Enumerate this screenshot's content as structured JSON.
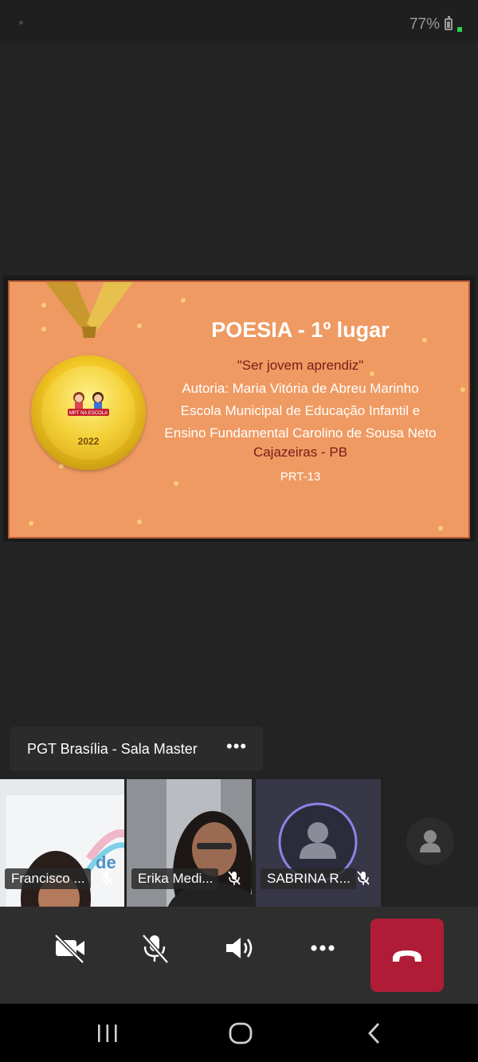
{
  "status_bar": {
    "battery_percent": "77%"
  },
  "slide": {
    "title": "POESIA - 1º lugar",
    "quote": "\"Ser jovem aprendiz\"",
    "author": "Autoria: Maria Vitória de Abreu Marinho",
    "school_line1": "Escola Municipal de Educação Infantil e",
    "school_line2": "Ensino Fundamental Carolino de Sousa Neto",
    "city": "Cajazeiras - PB",
    "prt": "PRT-13",
    "medal_year": "2022",
    "medal_logo_text": "MPT NA ESCOLA"
  },
  "room": {
    "name": "PGT Brasília - Sala Master",
    "more_label": "•••"
  },
  "participants": [
    {
      "name": "Francisco ...",
      "muted": true
    },
    {
      "name": "Erika Medi...",
      "muted": true
    },
    {
      "name": "SABRINA R...",
      "muted": true
    },
    {
      "name": "",
      "muted": false
    }
  ],
  "controls": {
    "camera": "camera-off",
    "microphone": "microphone-off",
    "speaker": "speaker-on",
    "more": "more-options",
    "hangup": "end-call"
  },
  "colors": {
    "slide_background": "#ef9a62",
    "accent_dark_red": "#7a1a1a",
    "hangup_red": "#b01c36",
    "battery_charge": "#2fd14a"
  }
}
